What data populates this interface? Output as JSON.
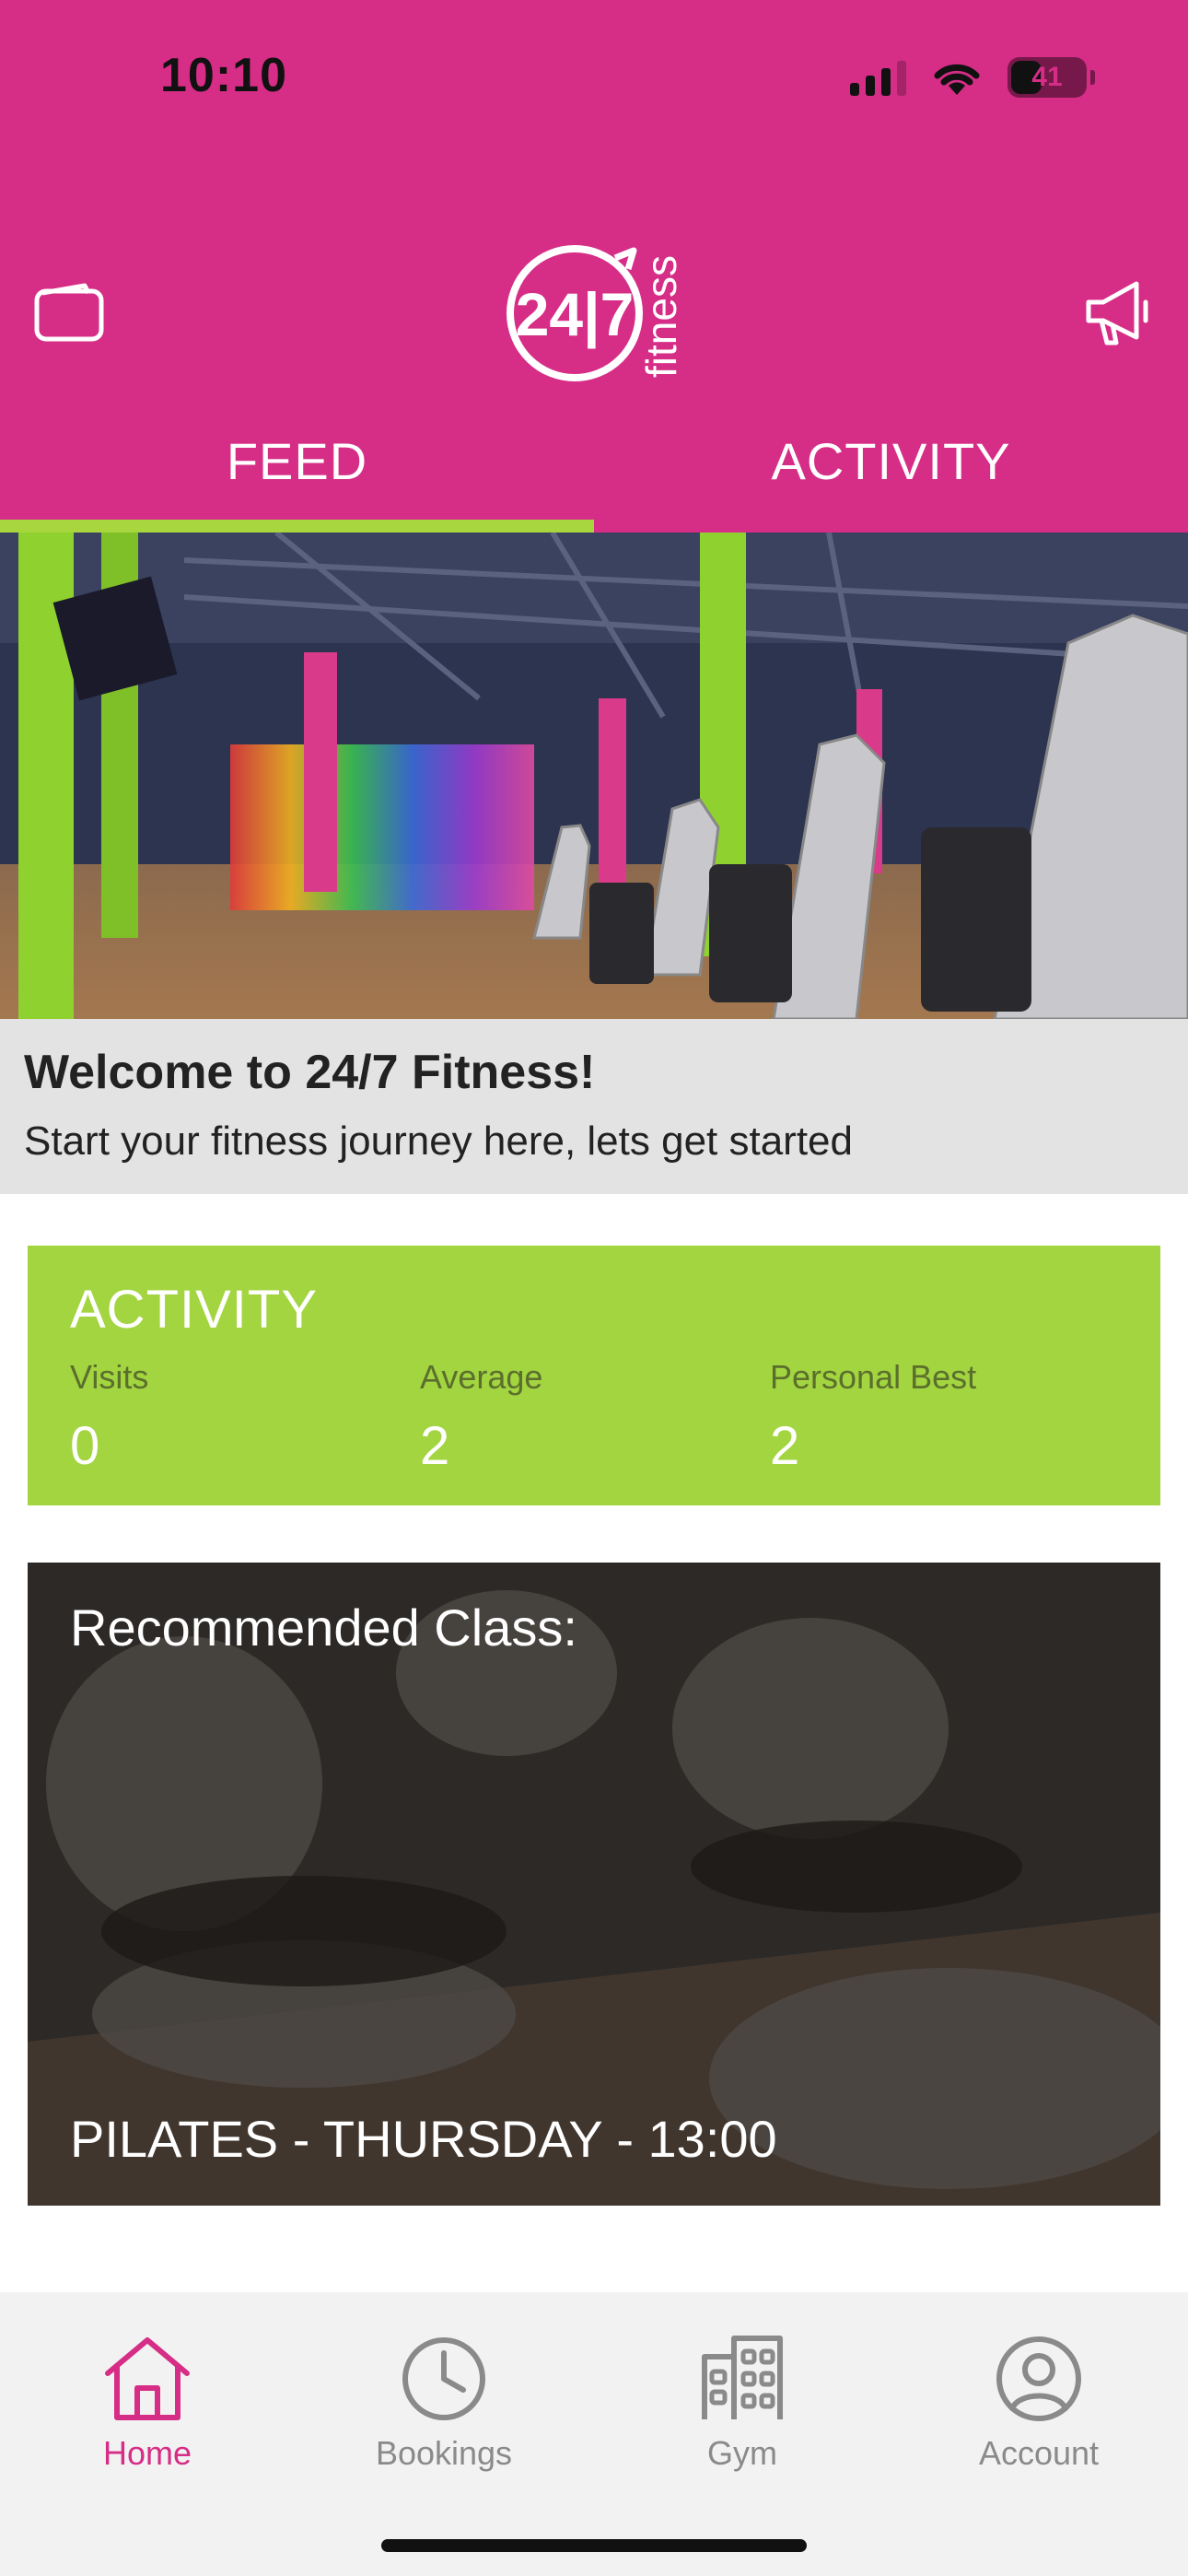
{
  "status_bar": {
    "time": "10:10",
    "battery": "41"
  },
  "header": {
    "logo_text": "24|7",
    "logo_sub": "fitness"
  },
  "tabs": [
    {
      "label": "FEED",
      "active": true
    },
    {
      "label": "ACTIVITY",
      "active": false
    }
  ],
  "welcome": {
    "title": "Welcome to 24/7 Fitness!",
    "subtitle": "Start your fitness journey here, lets get started"
  },
  "activity": {
    "title": "ACTIVITY",
    "stats": [
      {
        "label": "Visits",
        "value": "0"
      },
      {
        "label": "Average",
        "value": "2"
      },
      {
        "label": "Personal Best",
        "value": "2"
      }
    ]
  },
  "recommended": {
    "title": "Recommended Class:",
    "class": "PILATES - THURSDAY - 13:00"
  },
  "bottom_nav": [
    {
      "label": "Home",
      "icon": "home-icon",
      "active": true
    },
    {
      "label": "Bookings",
      "icon": "clock-icon",
      "active": false
    },
    {
      "label": "Gym",
      "icon": "building-icon",
      "active": false
    },
    {
      "label": "Account",
      "icon": "account-icon",
      "active": false
    }
  ],
  "colors": {
    "brand_pink": "#d62d86",
    "accent_green": "#a3d541",
    "tab_indicator": "#a8d63f"
  }
}
